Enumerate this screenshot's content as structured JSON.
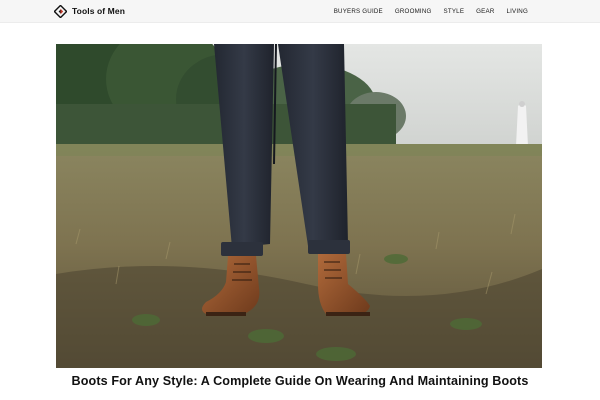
{
  "site": {
    "name": "Tools of Men",
    "logo_icon": "tools-of-men-logo-icon"
  },
  "nav": {
    "items": [
      {
        "label": "BUYERS GUIDE"
      },
      {
        "label": "GROOMING"
      },
      {
        "label": "STYLE"
      },
      {
        "label": "GEAR"
      },
      {
        "label": "LIVING"
      }
    ]
  },
  "article": {
    "title": "Boots For Any Style: A Complete Guide On Wearing And Maintaining Boots",
    "hero_image": "man-in-dark-chinos-and-brown-boots-standing-in-field"
  },
  "colors": {
    "topbar": "#f6f6f6",
    "text": "#111111",
    "boot_leather": "#9a5a32",
    "pants": "#2a2f3a",
    "grass": "#8a7f55"
  }
}
